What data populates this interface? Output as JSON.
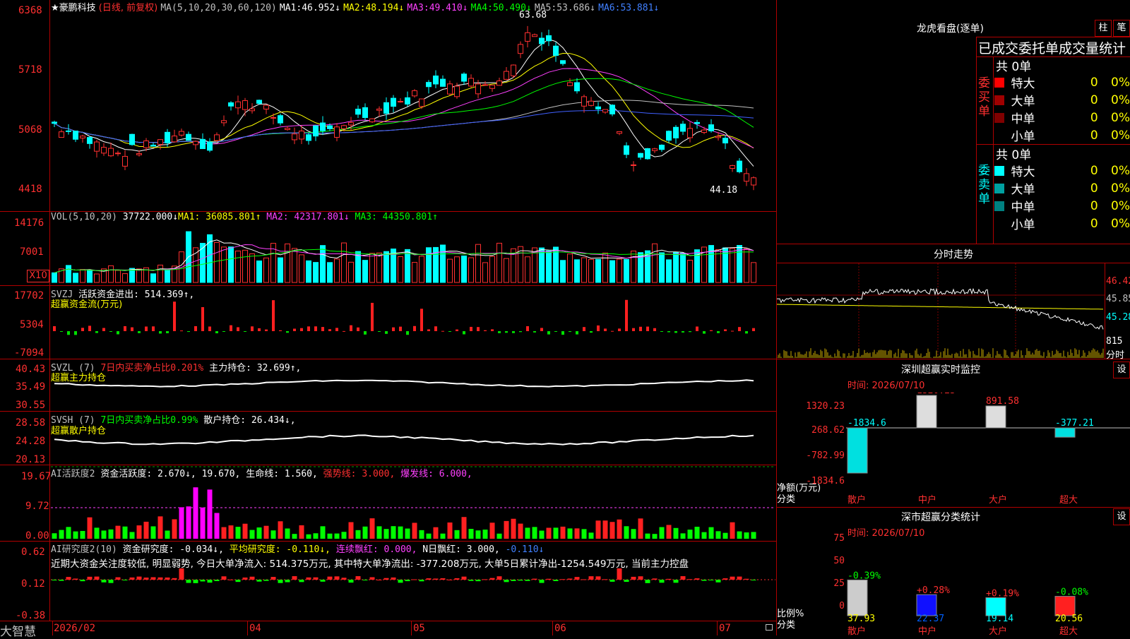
{
  "stock": {
    "name": "★豪鹏科技",
    "mode": "(日线, 前复权)",
    "ma_title": "MA(5,10,20,30,60,120)",
    "ma": [
      {
        "label": "MA1:",
        "value": "46.952↓",
        "color": "#ffffff"
      },
      {
        "label": "MA2:",
        "value": "48.194↓",
        "color": "#ffff00"
      },
      {
        "label": "MA3:",
        "value": "49.410↓",
        "color": "#ff40ff"
      },
      {
        "label": "MA4:",
        "value": "50.490↓",
        "color": "#00ff00"
      },
      {
        "label": "MA5:",
        "value": "53.686↓",
        "color": "#c0c0c0"
      },
      {
        "label": "MA6:",
        "value": "53.881↓",
        "color": "#4060ff"
      }
    ],
    "axis": [
      "6368",
      "5718",
      "5068",
      "4418"
    ],
    "high_label": "63.68",
    "low_label": "44.18"
  },
  "vol": {
    "title": "VOL(5,10,20)",
    "value": "37722.000↓",
    "ma1": "MA1: 36085.801↑",
    "ma2": "MA2: 42317.801↓",
    "ma3": "MA3: 44350.801↑",
    "axis": [
      "14176",
      "7001"
    ],
    "unit": "X10"
  },
  "svzj": {
    "title": "SVZJ",
    "label": "活跃资金进出: 514.369↑,",
    "sub": "超赢资金流(万元)",
    "axis": [
      "17702",
      "5304",
      "-7094"
    ]
  },
  "svzl": {
    "title": "SVZL (7)",
    "label1": "7日内买卖净占比0.201%",
    "label2": "主力持仓: 32.699↑,",
    "sub": "超赢主力持仓",
    "axis": [
      "40.43",
      "35.49",
      "30.55"
    ]
  },
  "svsh": {
    "title": "SVSH (7)",
    "label1": "7日内买卖净占比0.99%",
    "label2": "散户持仓: 26.434↓,",
    "sub": "超赢散户持仓",
    "axis": [
      "28.58",
      "24.28",
      "20.13"
    ]
  },
  "ai1": {
    "title": "AI活跃度2",
    "l1": "资金活跃度: 2.670↓,",
    "l2": "19.670,",
    "l3": "生命线: 1.560,",
    "l4": "强势线: 3.000,",
    "l5": "爆发线: 6.000,",
    "axis": [
      "19.67",
      "9.72",
      "0.00"
    ]
  },
  "ai2": {
    "title": "AI研究度2(10)",
    "l1": "资金研究度: -0.034↓,",
    "l2": "平均研究度: -0.110↓,",
    "l3": "连续飘红: 0.000,",
    "l4": "N日飘红: 3.000,",
    "l5": "-0.110↓",
    "comment": "近期大资金关注度较低, 明显弱势, 今日大单净流入: 514.375万元, 其中特大单净流出: -377.208万元, 大单5日累计净出-1254.549万元, 当前主力控盘",
    "axis": [
      "0.62",
      "0.12",
      "-0.38"
    ]
  },
  "footer": {
    "brand": "大智慧",
    "dates": [
      "2026/02",
      "04",
      "05",
      "06",
      "07"
    ]
  },
  "right": {
    "dragon_title": "龙虎看盘(逐单)",
    "btn_zhu": "柱",
    "btn_bi": "笔",
    "stats_header": "已成交委托单成交量统计",
    "buy": {
      "side": "委买单",
      "total": "共 0单",
      "rows": [
        {
          "name": "特大",
          "count": "0",
          "pct": "0%",
          "color": "#ff0000"
        },
        {
          "name": "大单",
          "count": "0",
          "pct": "0%",
          "color": "#a00000"
        },
        {
          "name": "中单",
          "count": "0",
          "pct": "0%",
          "color": "#800000"
        },
        {
          "name": "小单",
          "count": "0",
          "pct": "0%",
          "color": "#000000"
        }
      ]
    },
    "sell": {
      "side": "委卖单",
      "total": "共 0单",
      "rows": [
        {
          "name": "特大",
          "count": "0",
          "pct": "0%",
          "color": "#00ffff"
        },
        {
          "name": "大单",
          "count": "0",
          "pct": "0%",
          "color": "#00a0a0"
        },
        {
          "name": "中单",
          "count": "0",
          "pct": "0%",
          "color": "#008080"
        },
        {
          "name": "小单",
          "count": "0",
          "pct": "0%",
          "color": "#000000"
        }
      ]
    },
    "intraday_title": "分时走势",
    "intraday_axis": [
      "46.42",
      "45.85",
      "45.28"
    ],
    "intraday_vol": "815",
    "intraday_vol_unit": "分时",
    "sz_title": "深圳超赢实时监控",
    "sz_btn": "设",
    "sz_time": "时间: 2026/07/10",
    "sz_axis": [
      "1320.23",
      "268.62",
      "-782.99",
      "-1834.6"
    ],
    "sz_ylabel": "净额(万元)",
    "sz_xlabel": "分类",
    "sz_bars": [
      {
        "cat": "散户",
        "value": "-1834.6",
        "v": -1834.6
      },
      {
        "cat": "中户",
        "value": "1320.23",
        "v": 1320.23
      },
      {
        "cat": "大户",
        "value": "891.58",
        "v": 891.58
      },
      {
        "cat": "超大",
        "value": "-377.21",
        "v": -377.21
      }
    ],
    "cls_title": "深市超赢分类统计",
    "cls_btn": "设",
    "cls_time": "时间: 2026/07/10",
    "cls_axis": [
      "75",
      "50",
      "25",
      "0"
    ],
    "cls_ylabel": "比例%",
    "cls_xlabel": "分类",
    "cls_bars": [
      {
        "cat": "散户",
        "value": "37.93",
        "chg": "-0.39%",
        "v": 37.93
      },
      {
        "cat": "中户",
        "value": "22.37",
        "chg": "+0.28%",
        "v": 22.37
      },
      {
        "cat": "大户",
        "value": "19.14",
        "chg": "+0.19%",
        "v": 19.14
      },
      {
        "cat": "超大",
        "value": "20.56",
        "chg": "-0.08%",
        "v": 20.56
      }
    ]
  }
}
